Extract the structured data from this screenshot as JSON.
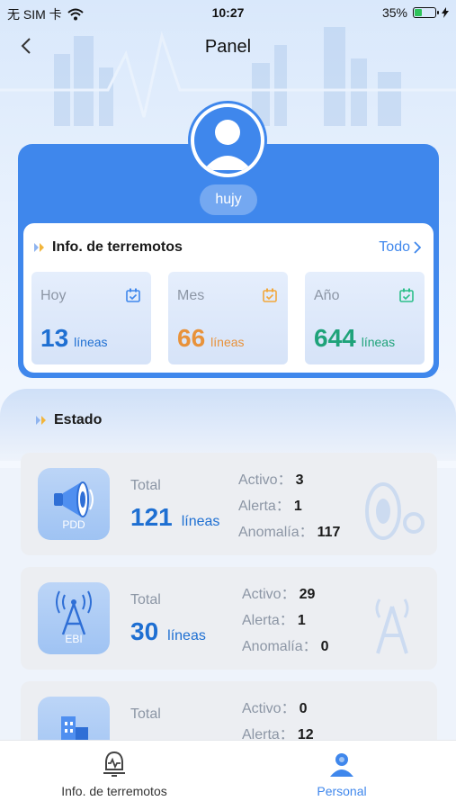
{
  "status_bar": {
    "carrier": "无 SIM 卡",
    "time": "10:27",
    "battery": "35%",
    "battery_level": 0.35
  },
  "nav": {
    "title": "Panel"
  },
  "profile": {
    "username": "hujy"
  },
  "earthquake_info": {
    "title": "Info. de terremotos",
    "all_link": "Todo",
    "stats": [
      {
        "label": "Hoy",
        "value": "13",
        "unit": "líneas",
        "color": "#1e6fd2",
        "cal_color": "#3f87ec"
      },
      {
        "label": "Mes",
        "value": "66",
        "unit": "líneas",
        "color": "#e8923a",
        "cal_color": "#f2a73b"
      },
      {
        "label": "Año",
        "value": "644",
        "unit": "líneas",
        "color": "#1fa37a",
        "cal_color": "#2cbf8a"
      }
    ]
  },
  "estado": {
    "title": "Estado",
    "devices": [
      {
        "code": "PDD",
        "icon": "megaphone-icon",
        "total_label": "Total",
        "total": "121",
        "unit": "líneas",
        "counts": [
          {
            "label": "Activo：",
            "value": "3"
          },
          {
            "label": "Alerta：",
            "value": "1"
          },
          {
            "label": "Anomalía：",
            "value": "117"
          }
        ]
      },
      {
        "code": "EBI",
        "icon": "antenna-tower-icon",
        "total_label": "Total",
        "total": "30",
        "unit": "líneas",
        "counts": [
          {
            "label": "Activo：",
            "value": "29"
          },
          {
            "label": "Alerta：",
            "value": "1"
          },
          {
            "label": "Anomalía：",
            "value": "0"
          }
        ]
      },
      {
        "code": "",
        "icon": "building-icon",
        "total_label": "Total",
        "total": "",
        "unit": "",
        "counts": [
          {
            "label": "Activo：",
            "value": "0"
          },
          {
            "label": "Alerta：",
            "value": "12"
          }
        ]
      }
    ]
  },
  "tabs": [
    {
      "label": "Info. de terremotos",
      "icon": "bell-pulse-icon",
      "active": false,
      "color": "#333333"
    },
    {
      "label": "Personal",
      "icon": "person-icon",
      "active": true,
      "color": "#3f87ec"
    }
  ]
}
